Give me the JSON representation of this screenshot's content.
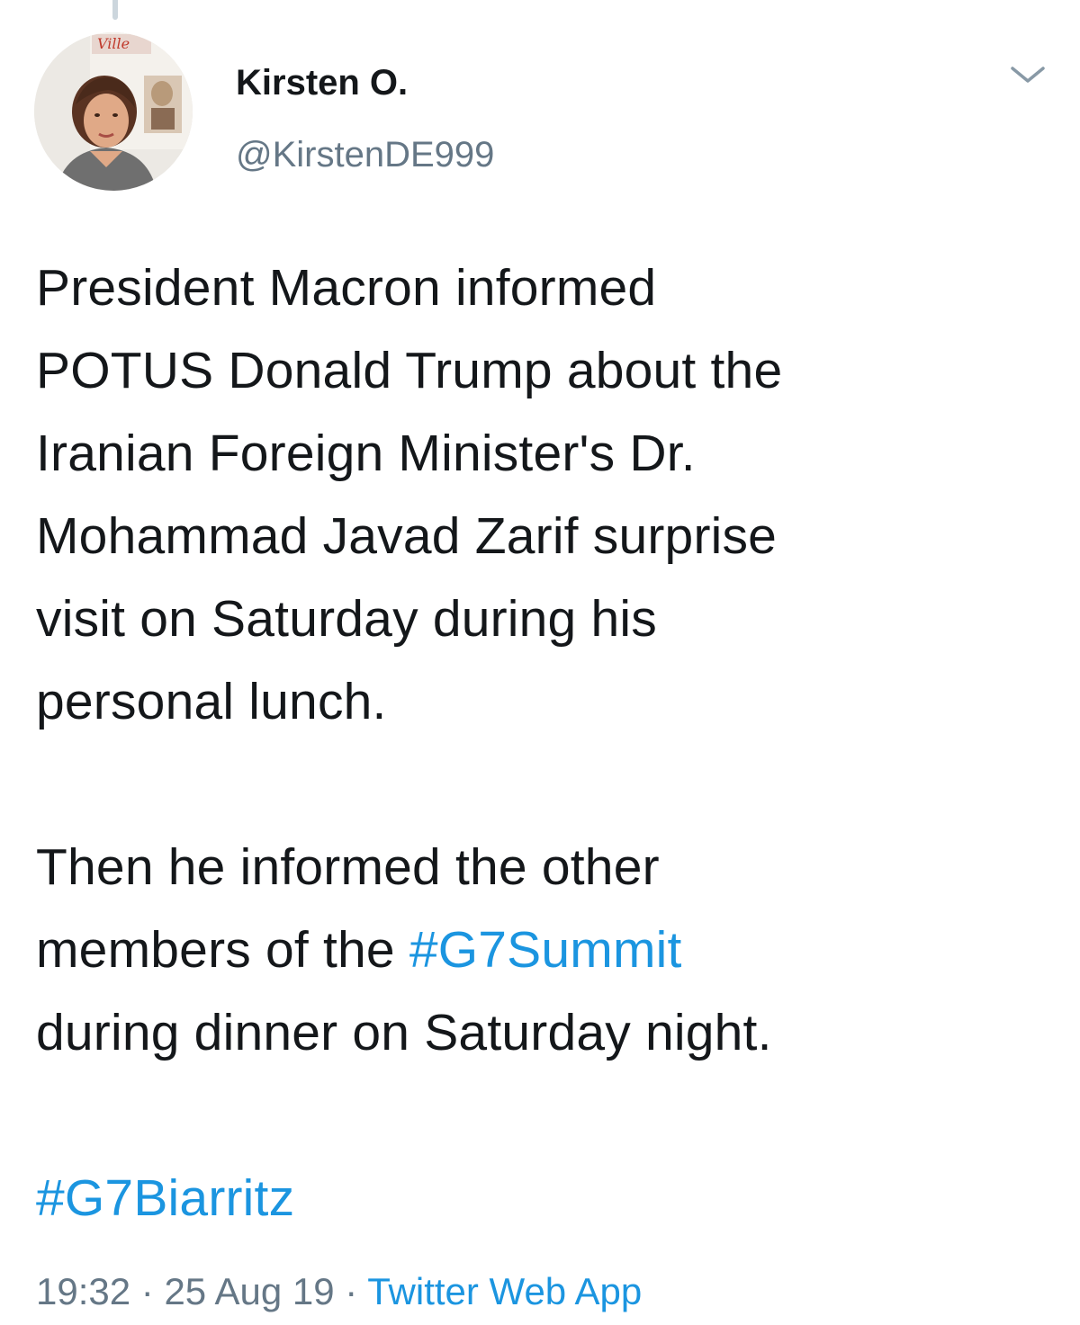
{
  "author": {
    "display_name": "Kirsten O.",
    "handle": "@KirstenDE999",
    "avatar_icon": "profile-photo",
    "avatar_sign_text": "Ville"
  },
  "menu": {
    "icon": "chevron-down-icon"
  },
  "tweet": {
    "paragraph1": [
      "President Macron informed",
      "POTUS Donald Trump about the",
      "Iranian Foreign Minister's Dr.",
      "Mohammad Javad Zarif surprise",
      "visit on Saturday during his",
      "personal lunch."
    ],
    "paragraph2": {
      "line1": "Then he informed the other",
      "line2_prefix": "members of the ",
      "hashtag1": "#G7Summit",
      "line3": "during dinner on Saturday night."
    },
    "hashtag2": "#G7Biarritz"
  },
  "meta": {
    "time": "19:32",
    "separator": " · ",
    "date": "25 Aug 19",
    "source": "Twitter Web App"
  },
  "colors": {
    "text": "#14171a",
    "secondary": "#657786",
    "link": "#1b95e0",
    "thread_line": "#ccd6dd"
  }
}
